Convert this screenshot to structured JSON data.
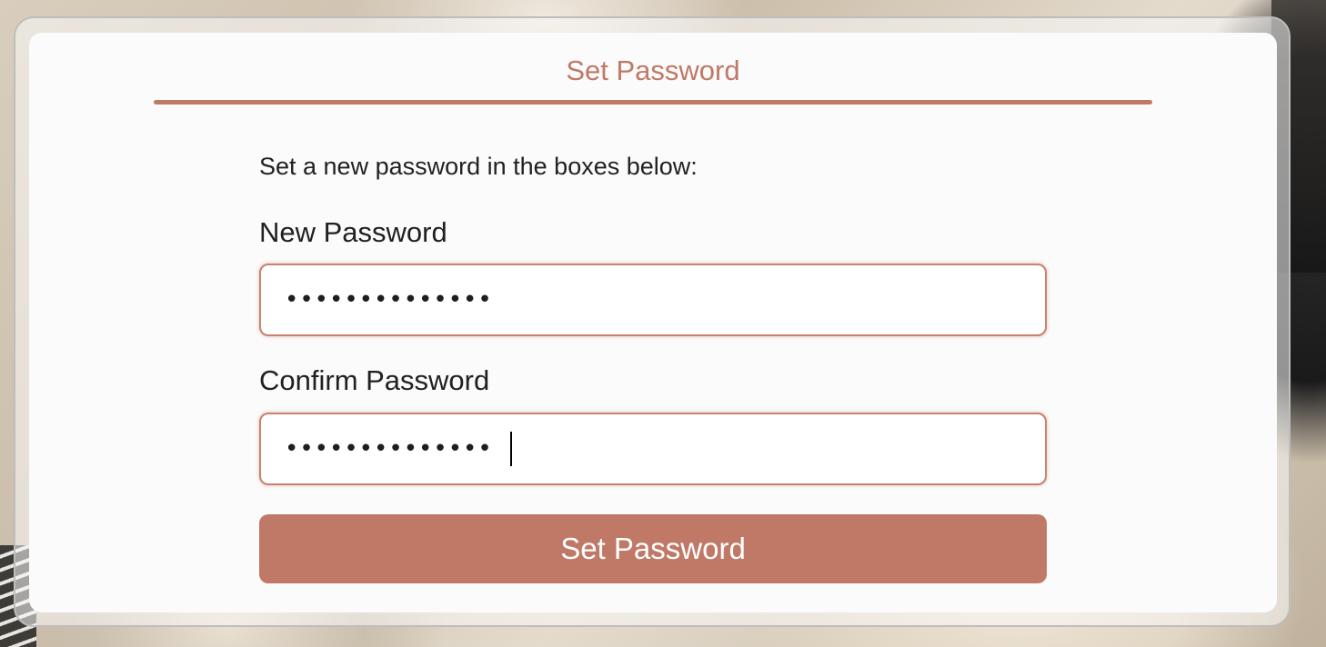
{
  "form": {
    "title": "Set Password",
    "instruction": "Set a new password in the boxes below:",
    "new_password": {
      "label": "New Password",
      "value": "••••••••••••••"
    },
    "confirm_password": {
      "label": "Confirm Password",
      "value": "••••••••••••••"
    },
    "submit_label": "Set Password"
  },
  "colors": {
    "accent": "#c07967",
    "text": "#212121",
    "card_background": "#fbfbfb"
  }
}
